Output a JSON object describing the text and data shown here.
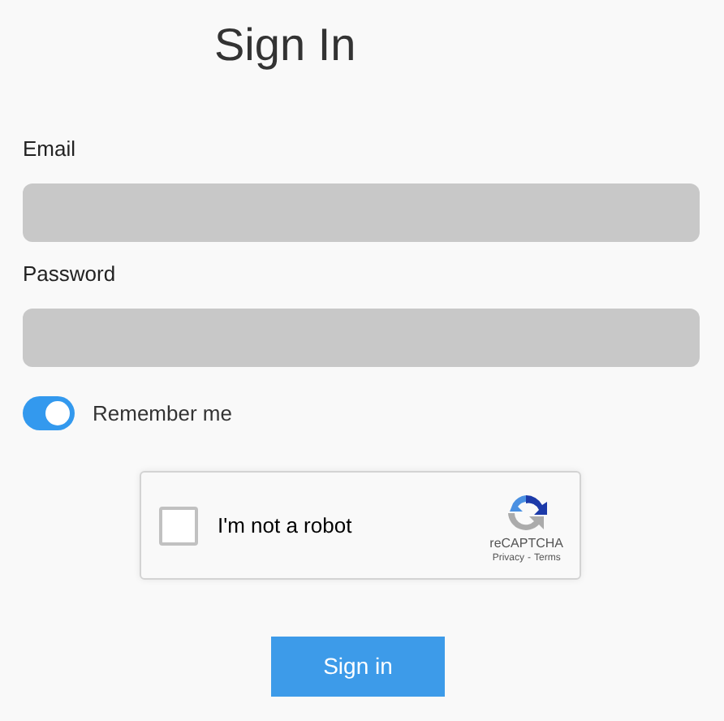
{
  "title": "Sign In",
  "fields": [
    {
      "label": "Email"
    },
    {
      "label": "Password"
    }
  ],
  "remember": {
    "label": "Remember me",
    "on": true
  },
  "captcha": {
    "label": "I'm not a robot",
    "checked": false,
    "brand": "reCAPTCHA",
    "privacy": "Privacy",
    "separator": "-",
    "terms": "Terms"
  },
  "submit": "Sign in"
}
